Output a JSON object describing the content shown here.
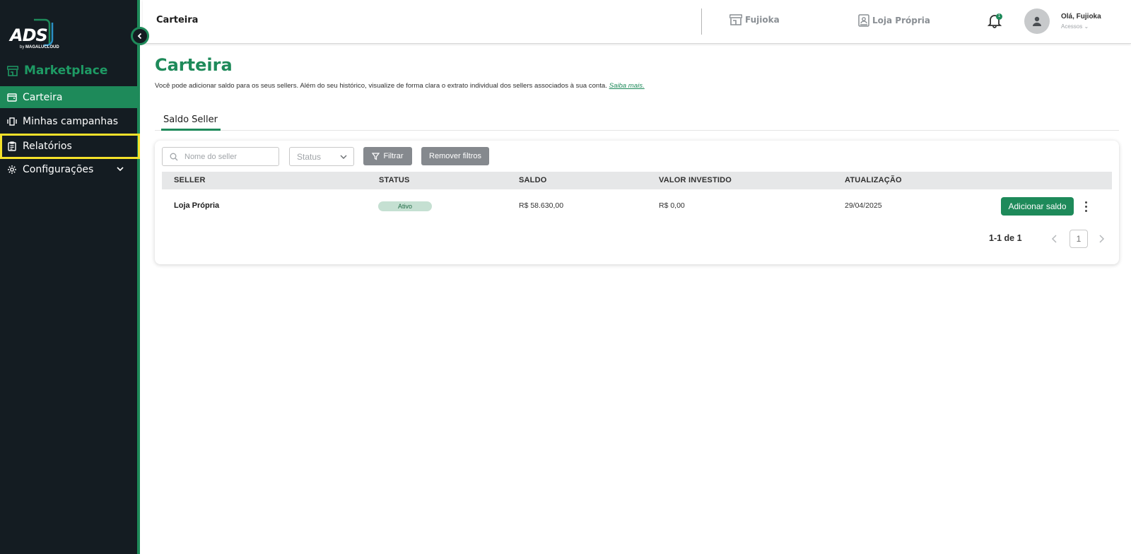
{
  "sidebar": {
    "logo": {
      "text": "ADS",
      "by": "by",
      "brand": "MAGALUCLOUD"
    },
    "section_title": "Marketplace",
    "items": [
      {
        "label": "Carteira",
        "icon": "wallet-icon",
        "active": true
      },
      {
        "label": "Minhas campanhas",
        "icon": "campaigns-icon",
        "active": false
      },
      {
        "label": "Relatórios",
        "icon": "report-icon",
        "active": false,
        "highlighted": true
      },
      {
        "label": "Configurações",
        "icon": "gear-icon",
        "active": false,
        "expandable": true
      }
    ]
  },
  "header": {
    "title": "Carteira",
    "stores": [
      {
        "label": "Fujioka",
        "icon": "store-icon"
      },
      {
        "label": "Loja Própria",
        "icon": "id-badge-icon"
      }
    ],
    "notifications": {
      "count": "1"
    },
    "user": {
      "greeting": "Olá, Fujioka",
      "menu_label": "Acessos"
    }
  },
  "main": {
    "title": "Carteira",
    "description": "Você pode adicionar saldo para os seus sellers. Além do seu histórico, visualize de forma clara o extrato individual dos sellers associados à sua conta.",
    "learn_more": "Saiba mais.",
    "tabs": [
      {
        "label": "Saldo Seller",
        "active": true
      }
    ],
    "filters": {
      "search_placeholder": "Nome do seller",
      "status_placeholder": "Status",
      "filter_button": "Filtrar",
      "remove_button": "Remover filtros"
    },
    "table": {
      "columns": [
        "SELLER",
        "STATUS",
        "SALDO",
        "VALOR INVESTIDO",
        "ATUALIZAÇÃO"
      ],
      "rows": [
        {
          "seller": "Loja Própria",
          "status": "Ativo",
          "saldo": "R$ 58.630,00",
          "valor_investido": "R$ 0,00",
          "atualizacao": "29/04/2025",
          "action": "Adicionar saldo"
        }
      ]
    },
    "pagination": {
      "summary": "1-1 de 1",
      "current_page": "1"
    }
  },
  "colors": {
    "accent": "#1e8a5a",
    "sidebar_bg": "#141c22",
    "highlight": "#f5e12a",
    "button_gray": "#85898e"
  }
}
